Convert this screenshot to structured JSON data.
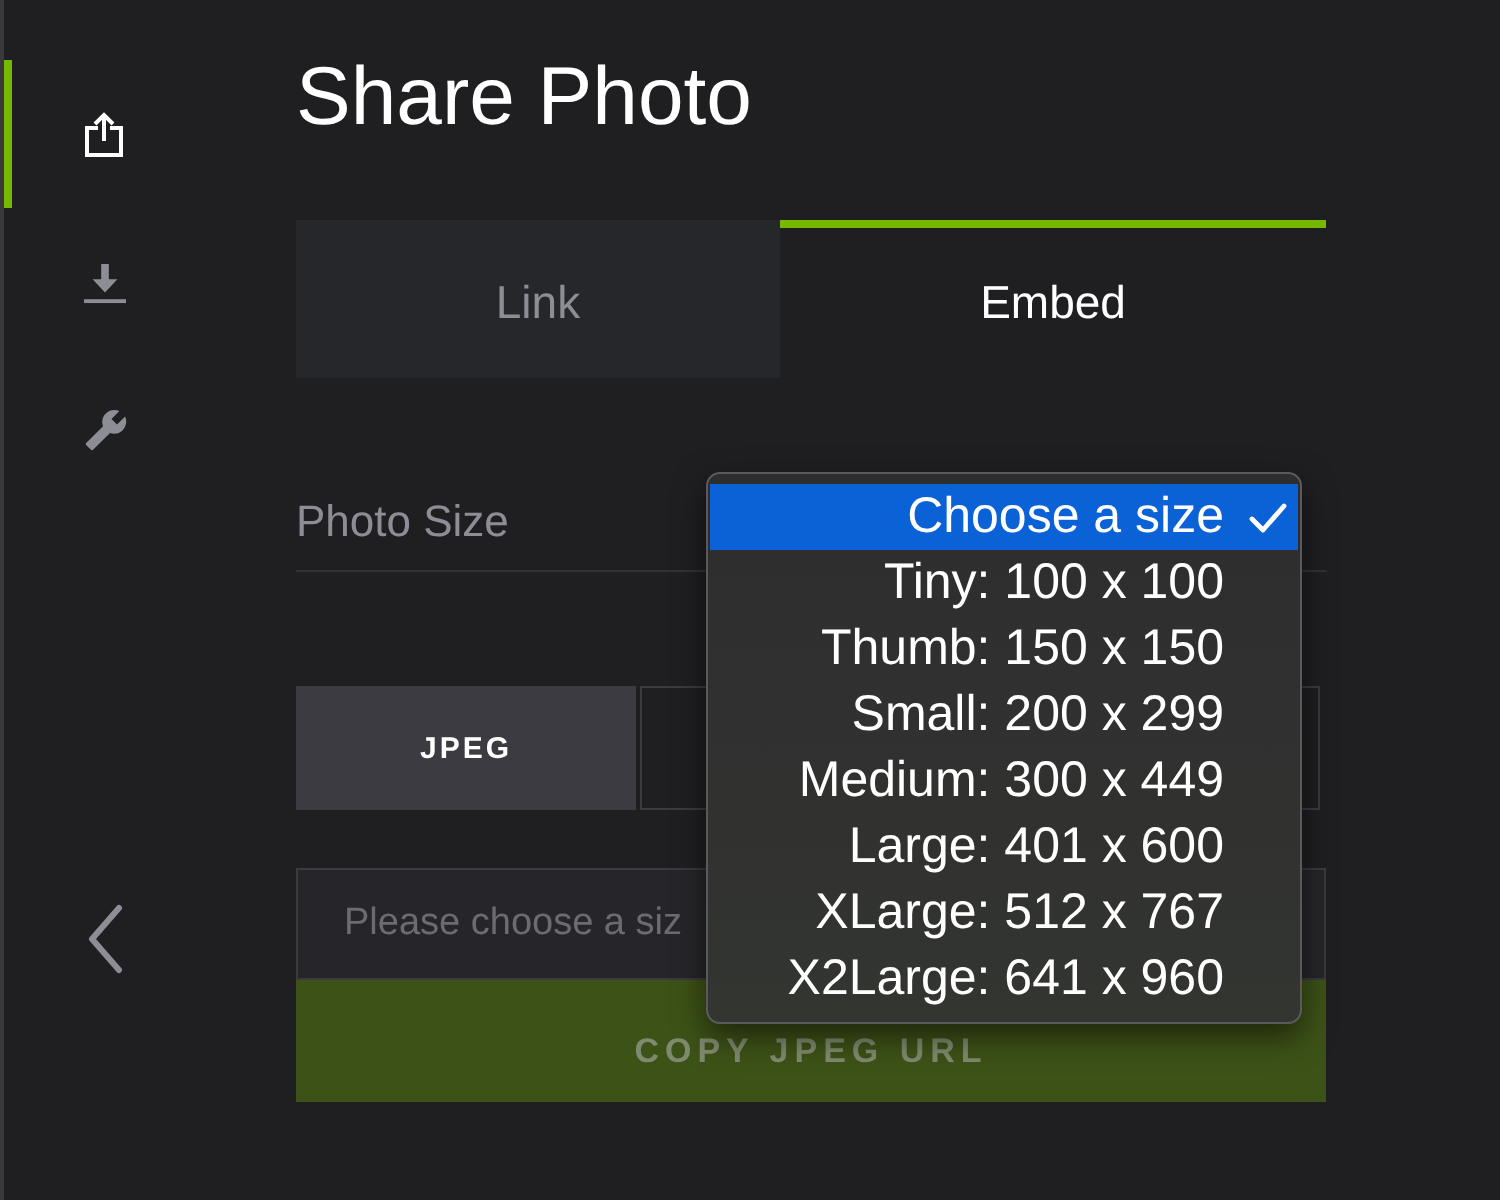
{
  "sidebar": {
    "items": [
      {
        "kind": "share",
        "selected": true
      },
      {
        "kind": "download",
        "selected": false
      },
      {
        "kind": "tools",
        "selected": false
      }
    ]
  },
  "title": "Share Photo",
  "tabs": [
    {
      "label": "Link",
      "selected": false
    },
    {
      "label": "Embed",
      "selected": true
    }
  ],
  "photo_size": {
    "label": "Photo Size",
    "menu": {
      "options": [
        {
          "label": "Choose a size",
          "selected": true,
          "highlighted": true
        },
        {
          "label": "Tiny: 100 x 100",
          "selected": false,
          "highlighted": false
        },
        {
          "label": "Thumb: 150 x 150",
          "selected": false,
          "highlighted": false
        },
        {
          "label": "Small: 200 x 299",
          "selected": false,
          "highlighted": false
        },
        {
          "label": "Medium: 300 x 449",
          "selected": false,
          "highlighted": false
        },
        {
          "label": "Large: 401 x 600",
          "selected": false,
          "highlighted": false
        },
        {
          "label": "XLarge: 512 x 767",
          "selected": false,
          "highlighted": false
        },
        {
          "label": "X2Large: 641 x 960",
          "selected": false,
          "highlighted": false
        }
      ]
    }
  },
  "formats": [
    {
      "label": "JPEG",
      "selected": true
    },
    {
      "selected": false
    }
  ],
  "url_field": {
    "placeholder": "Please choose a siz"
  },
  "copy_button": {
    "label": "COPY JPEG URL",
    "disabled": true
  }
}
